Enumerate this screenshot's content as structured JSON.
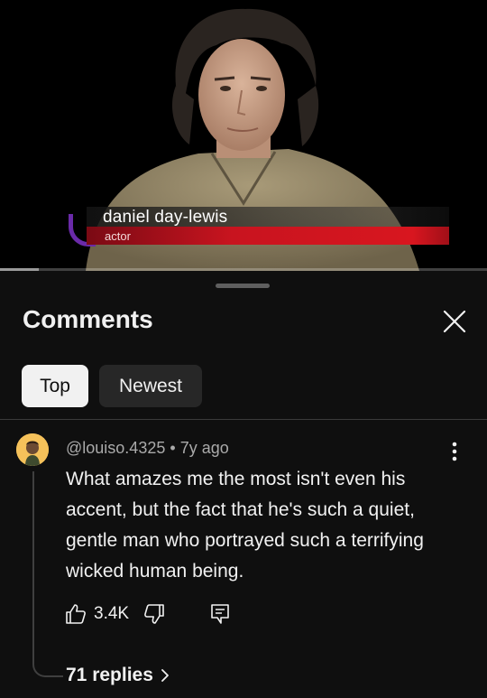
{
  "video": {
    "lower_third_name": "daniel day-lewis",
    "lower_third_role": "actor",
    "progress_fraction": 0.08
  },
  "sheet": {
    "title": "Comments",
    "close_icon": "close-icon"
  },
  "filters": [
    {
      "label": "Top",
      "active": true
    },
    {
      "label": "Newest",
      "active": false
    }
  ],
  "comment": {
    "handle": "@louiso.4325",
    "separator": "•",
    "age": "7y ago",
    "text": "What amazes me the most isn't even his accent, but the fact that he's such a quiet, gentle man who portrayed such a terrifying wicked human being.",
    "likes": "3.4K",
    "replies_label": "71 replies",
    "icons": {
      "like": "thumbs-up-icon",
      "dislike": "thumbs-down-icon",
      "reply": "reply-comment-icon",
      "more": "more-vertical-icon",
      "chevron": "chevron-right-icon"
    },
    "avatar_color": "#f5c15a"
  }
}
